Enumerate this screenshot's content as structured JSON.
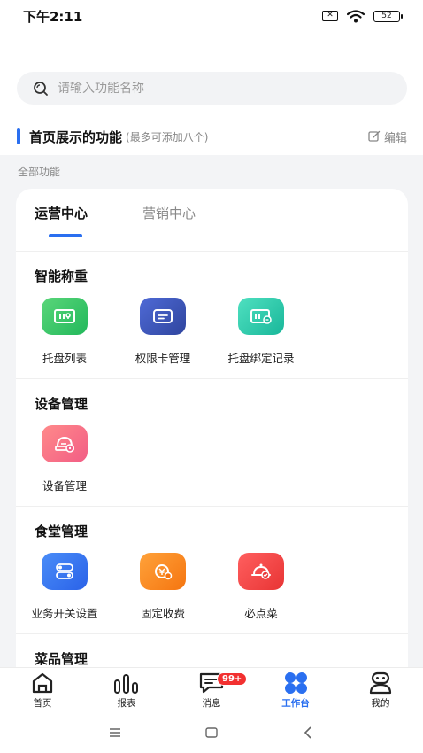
{
  "status_bar": {
    "time": "下午2:11",
    "battery": "52"
  },
  "search": {
    "placeholder": "请输入功能名称"
  },
  "featured": {
    "title": "首页展示的功能",
    "subtitle": "(最多可添加八个)",
    "edit_label": "编辑"
  },
  "all_functions_label": "全部功能",
  "tabs": [
    {
      "label": "运营中心",
      "active": true
    },
    {
      "label": "营销中心",
      "active": false
    }
  ],
  "sections": [
    {
      "title": "智能称重",
      "items": [
        {
          "label": "托盘列表",
          "icon": "tray-list-icon",
          "color": "#22b85b"
        },
        {
          "label": "权限卡管理",
          "icon": "permission-card-icon",
          "color": "#2f459e"
        },
        {
          "label": "托盘绑定记录",
          "icon": "tray-binding-icon",
          "color": "#19b79a"
        }
      ]
    },
    {
      "title": "设备管理",
      "items": [
        {
          "label": "设备管理",
          "icon": "device-settings-icon",
          "color": "#f25d85"
        }
      ]
    },
    {
      "title": "食堂管理",
      "items": [
        {
          "label": "业务开关设置",
          "icon": "toggle-switch-icon",
          "color": "#2a62e8"
        },
        {
          "label": "固定收费",
          "icon": "fixed-fee-icon",
          "color": "#f57510"
        },
        {
          "label": "必点菜",
          "icon": "must-order-dish-icon",
          "color": "#e83434"
        }
      ]
    },
    {
      "title": "菜品管理",
      "items": []
    }
  ],
  "tabbar": [
    {
      "label": "首页",
      "icon": "home-icon",
      "active": false
    },
    {
      "label": "报表",
      "icon": "report-icon",
      "active": false
    },
    {
      "label": "消息",
      "icon": "message-icon",
      "active": false,
      "badge": "99+"
    },
    {
      "label": "工作台",
      "icon": "workbench-icon",
      "active": true
    },
    {
      "label": "我的",
      "icon": "profile-icon",
      "active": false
    }
  ],
  "colors": {
    "accent": "#2a6ff0",
    "badge": "#f23030"
  }
}
